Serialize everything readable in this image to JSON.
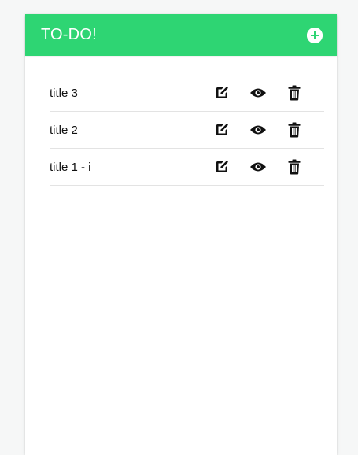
{
  "header": {
    "title": "TO-DO!",
    "background_color": "#2ed573",
    "add_icon": "plus-circle-icon"
  },
  "todos": [
    {
      "title": "title 3"
    },
    {
      "title": "title 2"
    },
    {
      "title": "title 1 - i"
    }
  ],
  "actions": {
    "edit_icon": "edit-icon",
    "view_icon": "eye-icon",
    "delete_icon": "trash-icon"
  }
}
